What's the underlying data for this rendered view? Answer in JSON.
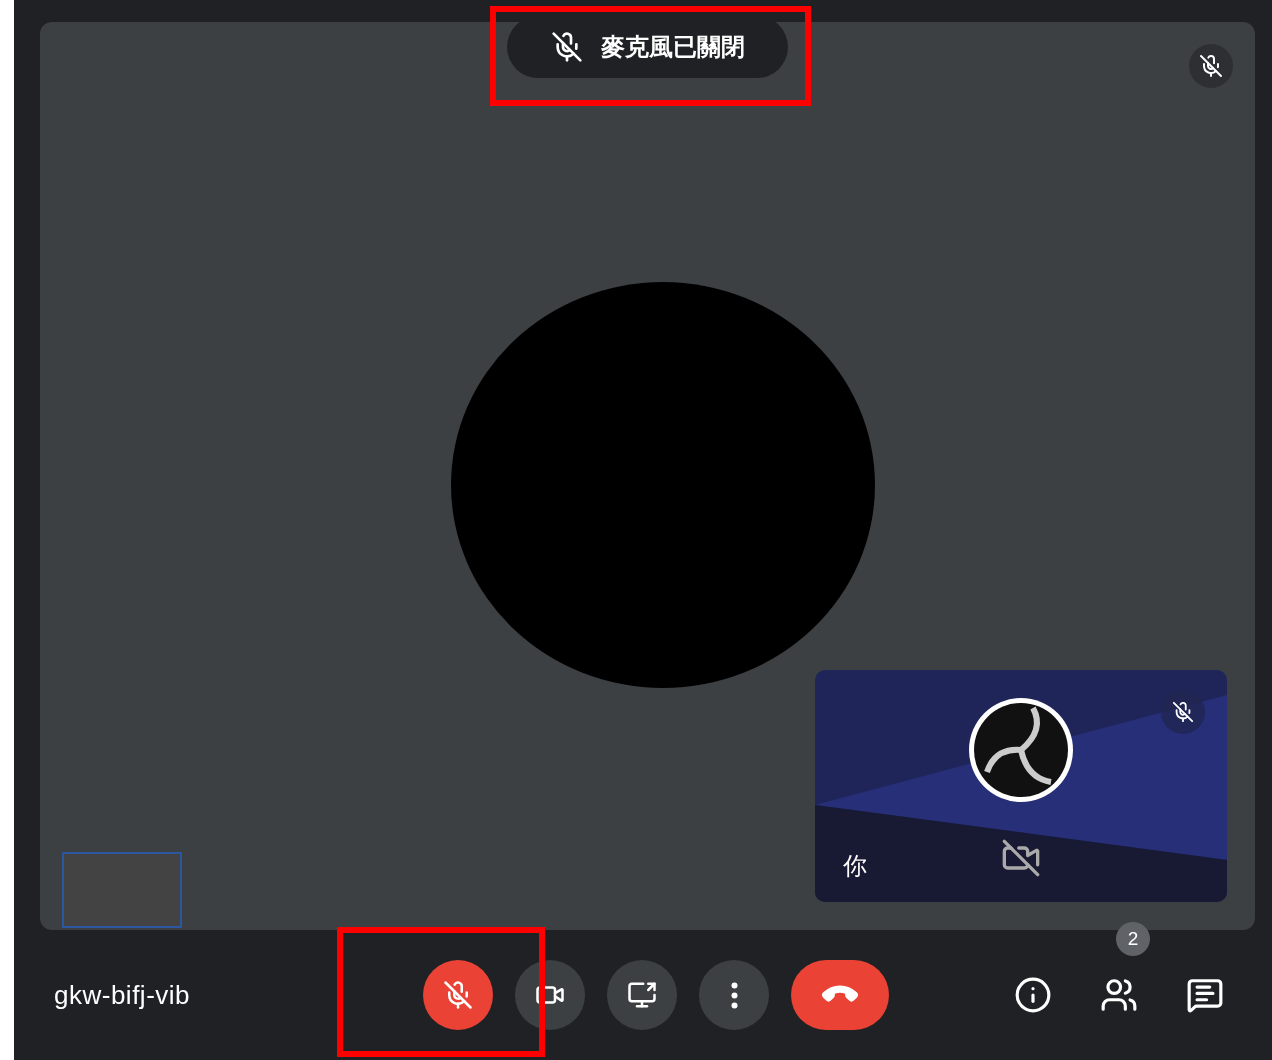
{
  "banner": {
    "text": "麥克風已關閉"
  },
  "stage": {
    "speaker_muted": true
  },
  "self_view": {
    "label": "你",
    "muted": true,
    "camera_on": false
  },
  "meeting": {
    "code": "gkw-bifj-vib"
  },
  "controls": [
    {
      "kind": "mic",
      "on": false
    },
    {
      "kind": "camera",
      "on": true
    },
    {
      "kind": "present"
    },
    {
      "kind": "more"
    },
    {
      "kind": "hangup"
    }
  ],
  "side_actions": [
    {
      "kind": "info"
    },
    {
      "kind": "people",
      "badge": "2"
    },
    {
      "kind": "chat"
    }
  ]
}
